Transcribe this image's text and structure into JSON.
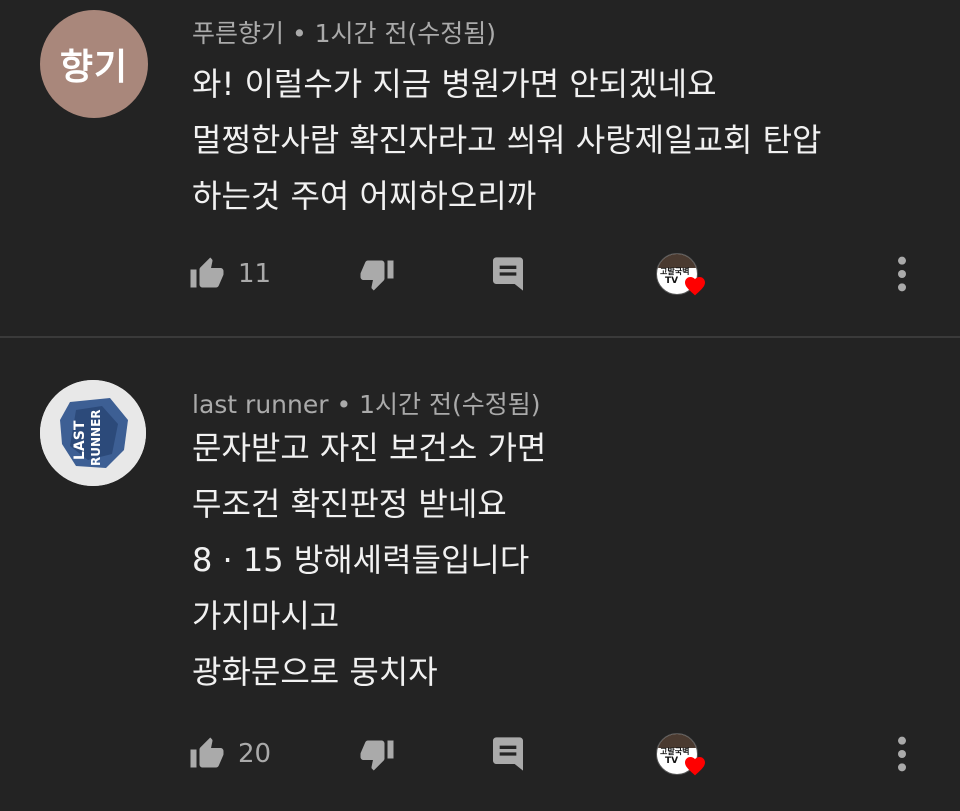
{
  "comments": [
    {
      "avatar_text": "향기",
      "author": "푸른향기",
      "meta": " • 1시간 전(수정됨)",
      "lines": [
        "와! 이럴수가 지금 병원가면 안되겠네요",
        "멀쩡한사람 확진자라고 씌워  사랑제일교회  탄압",
        "하는것  주여 어찌하오리까"
      ],
      "like_count": "11",
      "creator_badge": [
        "고발국벽",
        "TV"
      ]
    },
    {
      "avatar_text": "LAST RUNNER",
      "author": "last runner",
      "meta": " • 1시간 전(수정됨)",
      "lines": [
        "문자받고 자진 보건소 가면",
        "무조건 확진판정 받네요",
        "8 · 15  방해세력들입니다",
        "가지마시고",
        "광화문으로 뭉치자"
      ],
      "like_count": "20",
      "creator_badge": [
        "고발국벽",
        "TV"
      ]
    }
  ],
  "icons": {
    "like": "thumbs-up-icon",
    "dislike": "thumbs-down-icon",
    "reply": "reply-icon",
    "more": "more-vert-icon",
    "heart": "heart-icon"
  },
  "colors": {
    "background": "#232323",
    "text": "#f1f1f1",
    "meta": "#aaaaaa",
    "icon": "#aaaaaa",
    "heart": "#ff0000",
    "avatar1": "#a9877b"
  }
}
